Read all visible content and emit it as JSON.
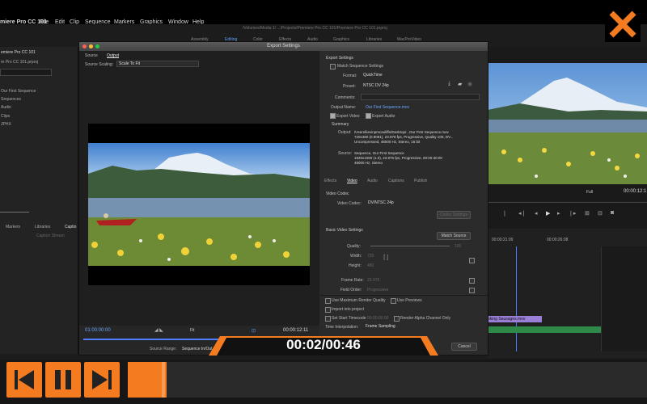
{
  "menubar": {
    "app_name": "miere Pro CC 101",
    "items": [
      "File",
      "Edit",
      "Clip",
      "Sequence",
      "Markers",
      "Graphics",
      "Window",
      "Help"
    ],
    "path": "/Volumes/Media 1/ .../Projects/Premiere Pro CC 101/Premiere Pro CC 101.prproj"
  },
  "workspaces": [
    "Assembly",
    "Editing",
    "Color",
    "Effects",
    "Audio",
    "Graphics",
    "Libraries",
    "MacProVideo"
  ],
  "project_panel": {
    "title": "emiere Pro CC 101",
    "file": "re Pro CC 101.prproj",
    "items": [
      "Our First Sequence",
      "Sequences",
      "Audio",
      "Clips",
      "JPHX"
    ],
    "bottom_tabs": [
      "Markers",
      "Libraries",
      "Captio"
    ],
    "caption_label": "Caption Stream"
  },
  "dialog": {
    "title": "Export Settings",
    "left_tabs": [
      "Source",
      "Output"
    ],
    "source_scaling_label": "Source Scaling:",
    "source_scaling_value": "Scale To Fit",
    "timecode_in": "01:00:00:00",
    "timecode_out": "00:00:12:11",
    "fit": "Fit",
    "source_range_label": "Source Range:",
    "source_range_value": "Sequence In/Out",
    "export_settings": {
      "header": "Export Settings",
      "match_seq": "Match Sequence Settings",
      "format_label": "Format:",
      "format_value": "QuickTime",
      "preset_label": "Preset:",
      "preset_value": "NTSC DV 24p",
      "comments_label": "Comments:",
      "output_name_label": "Output Name:",
      "output_name_value": "Our First Sequence.mov",
      "export_video": "Export Video",
      "export_audio": "Export Audio"
    },
    "summary": {
      "header": "Summary",
      "output_label": "Output:",
      "output_lines": [
        "/Users/kevinpmcauliffe/Desktop/...Our First Sequence.mov",
        "720x480 (0.9091), 23.976 fps, Progressive, Quality 100, DV...",
        "Uncompressed, 48000 Hz, Stereo, 16 bit"
      ],
      "source_label": "Source:",
      "source_lines": [
        "Sequence, Our First Sequence",
        "1920x1080 (1.0), 23.976 fps, Progressive, 00:00:30:00",
        "48000 Hz, Stereo"
      ]
    },
    "right_tabs": [
      "Effects",
      "Video",
      "Audio",
      "Captions",
      "Publish"
    ],
    "video_codec_header": "Video Codec",
    "video_codec_label": "Video Codec:",
    "video_codec_value": "DV/NTSC 24p",
    "codec_settings_btn": "Codec Settings",
    "basic_video_header": "Basic Video Settings",
    "match_source_btn": "Match Source",
    "quality_label": "Quality:",
    "quality_value": "100",
    "width_label": "Width:",
    "width_value": "720",
    "height_label": "Height:",
    "height_value": "480",
    "frame_rate_label": "Frame Rate:",
    "frame_rate_value": "23.976",
    "field_order_label": "Field Order:",
    "field_order_value": "Progressive",
    "bottom_opts": {
      "max_render": "Use Maximum Render Quality",
      "use_previews": "Use Previews",
      "import_proj": "Import into project",
      "set_start_tc": "Set Start Timecode",
      "start_tc_value": "00:00:00:00",
      "render_alpha": "Render Alpha Channel Only",
      "time_interp_label": "Time Interpolation:",
      "time_interp_value": "Frame Sampling"
    },
    "cancel_btn": "Cancel"
  },
  "program_monitor": {
    "fit": "Full",
    "timecode": "00:00:12:1"
  },
  "timeline": {
    "tc1": "00:00:21:09",
    "tc2": "00:00:26:08",
    "clip_name": "oking Sausages.mov"
  },
  "player": {
    "time_display": "00:02/00:46",
    "progress": 0.07,
    "accent": "#f47b20"
  }
}
